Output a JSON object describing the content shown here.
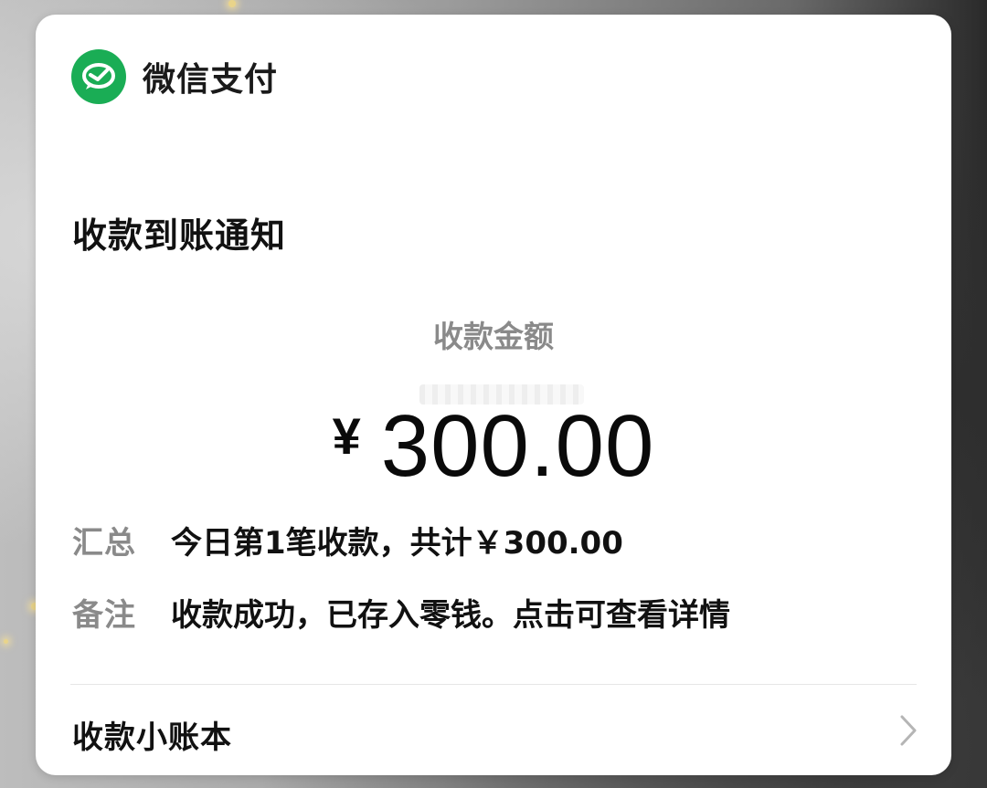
{
  "brand": {
    "name": "微信支付",
    "logo_icon": "wechat-pay-icon",
    "color": "#1AAD55"
  },
  "notice": {
    "title": "收款到账通知",
    "amount_label": "收款金额",
    "currency_symbol": "¥",
    "amount": "300.00"
  },
  "details": [
    {
      "key": "汇总",
      "value": "今日第1笔收款，共计￥300.00"
    },
    {
      "key": "备注",
      "value": "收款成功，已存入零钱。点击可查看详情"
    }
  ],
  "footer": {
    "ledger_label": "收款小账本",
    "chevron_icon": "chevron-right-icon"
  }
}
